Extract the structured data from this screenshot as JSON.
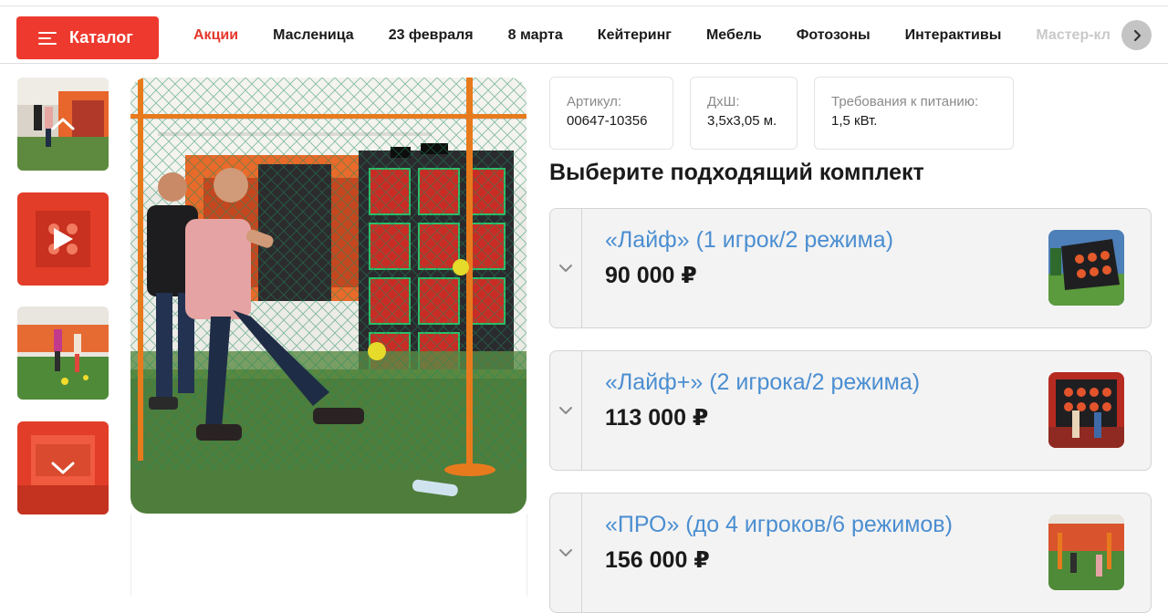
{
  "nav": {
    "catalog_label": "Каталог",
    "links": [
      "Акции",
      "Масленица",
      "23 февраля",
      "8 марта",
      "Кейтеринг",
      "Мебель",
      "Фотозоны",
      "Интерактивы",
      "Мастер-кл"
    ],
    "active": "Акции",
    "next_icon": "chevron-right-icon",
    "accent_color": "#ee3a2e"
  },
  "gallery": {
    "thumbs": [
      {
        "overlay_icon": "chevron-up-icon"
      },
      {
        "overlay_icon": "play-icon"
      },
      {
        "overlay_icon": ""
      },
      {
        "overlay_icon": "chevron-down-icon"
      }
    ]
  },
  "specs": [
    {
      "key": "Артикул:",
      "value": "00647-10356"
    },
    {
      "key": "ДхШ:",
      "value": "3,5х3,05 м."
    },
    {
      "key": "Требования к питанию:",
      "value": "1,5 кВт."
    }
  ],
  "section_title": "Выберите подходящий комплект",
  "kits": [
    {
      "name": "«Лайф» (1 игрок/2 режима)",
      "price": "90 000 ₽"
    },
    {
      "name": "«Лайф+» (2 игрока/2 режима)",
      "price": "113 000 ₽"
    },
    {
      "name": "«ПРО» (до 4 игроков/6 режимов)",
      "price": "156 000 ₽"
    }
  ],
  "link_color": "#4b8ed1"
}
